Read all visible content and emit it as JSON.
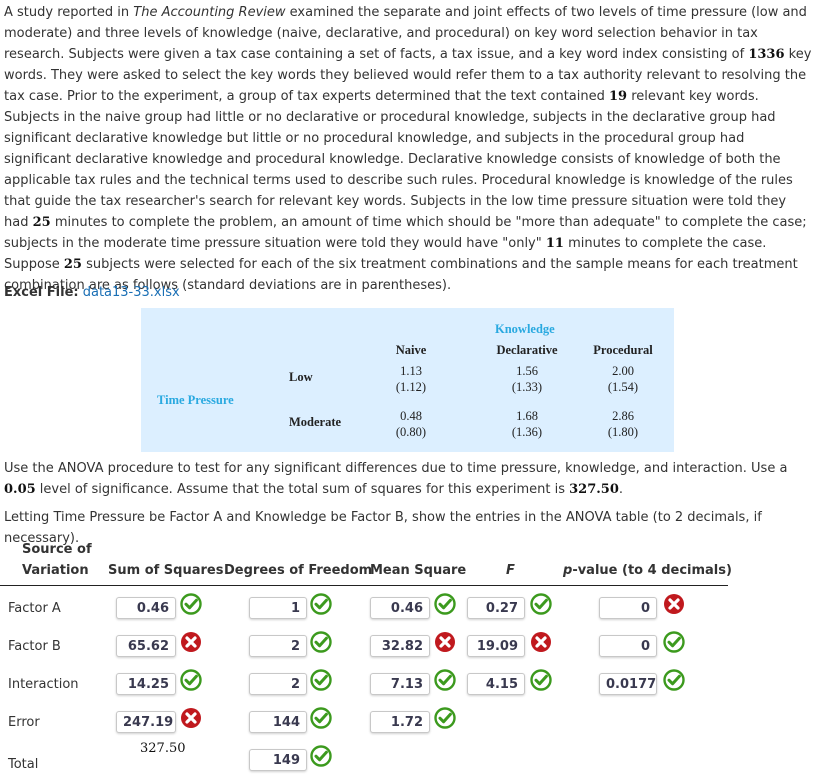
{
  "problem": {
    "intro_parts": [
      {
        "t": "A study reported in "
      },
      {
        "t": "The Accounting Review",
        "style": "italic"
      },
      {
        "t": " examined the separate and joint effects of two levels of time pressure (low and moderate) and three levels of knowledge (naive, declarative, and procedural) on key word selection behavior in tax research. Subjects were given a tax case containing a set of facts, a tax issue, and a key word index consisting of "
      },
      {
        "t": "1336",
        "style": "num"
      },
      {
        "t": " key words. They were asked to select the key words they believed would refer them to a tax authority relevant to resolving the tax case. Prior to the experiment, a group of tax experts determined that the text contained "
      },
      {
        "t": "19",
        "style": "num"
      },
      {
        "t": " relevant key words. Subjects in the naive group had little or no declarative or procedural knowledge, subjects in the declarative group had significant declarative knowledge but little or no procedural knowledge, and subjects in the procedural group had significant declarative knowledge and procedural knowledge. Declarative knowledge consists of knowledge of both the applicable tax rules and the technical terms used to describe such rules. Procedural knowledge is knowledge of the rules that guide the tax researcher's search for relevant key words. Subjects in the low time pressure situation were told they had "
      },
      {
        "t": "25",
        "style": "num"
      },
      {
        "t": " minutes to complete the problem, an amount of time which should be \"more than adequate\" to complete the case; subjects in the moderate time pressure situation were told they would have \"only\" "
      },
      {
        "t": "11",
        "style": "num"
      },
      {
        "t": " minutes to complete the case. Suppose "
      },
      {
        "t": "25",
        "style": "num"
      },
      {
        "t": " subjects were selected for each of the six treatment combinations and the sample means for each treatment combination are as follows (standard deviations are in parentheses)."
      }
    ],
    "excel_label": "Excel File:",
    "excel_link": "data13-33.xlsx",
    "instructions1_parts": [
      {
        "t": "Use the ANOVA procedure to test for any significant differences due to time pressure, knowledge, and interaction. Use a "
      },
      {
        "t": "0.05",
        "style": "num"
      },
      {
        "t": " level of significance. Assume that the total sum of squares for this experiment is "
      },
      {
        "t": "327.50",
        "style": "num"
      },
      {
        "t": "."
      }
    ],
    "instructions2": "Letting Time Pressure be Factor A and Knowledge be Factor B, show the entries in the ANOVA table (to 2 decimals, if necessary)."
  },
  "data_table": {
    "factor_col_title": "Knowledge",
    "factor_row_title": "Time Pressure",
    "columns": [
      "Naive",
      "Declarative",
      "Procedural"
    ],
    "rows": [
      {
        "label": "Low",
        "means": [
          "1.13",
          "1.56",
          "2.00"
        ],
        "sds": [
          "(1.12)",
          "(1.33)",
          "(1.54)"
        ]
      },
      {
        "label": "Moderate",
        "means": [
          "0.48",
          "1.68",
          "2.86"
        ],
        "sds": [
          "(0.80)",
          "(1.36)",
          "(1.80)"
        ]
      }
    ],
    "accent_color": "#29a9e0",
    "background_color": "#dcefff"
  },
  "anova": {
    "headers": {
      "source_line1": "Source of",
      "source_line2": "Variation",
      "ss": "Sum of Squares",
      "df": "Degrees of Freedom",
      "ms": "Mean Square",
      "f": "F",
      "p_prefix": "p",
      "p_suffix": "-value (to 4 decimals)"
    },
    "rows": [
      {
        "label": "Factor A",
        "ss": {
          "value": "0.46",
          "status": "correct"
        },
        "df": {
          "value": "1",
          "status": "correct"
        },
        "ms": {
          "value": "0.46",
          "status": "correct"
        },
        "f": {
          "value": "0.27",
          "status": "correct"
        },
        "p": {
          "value": "0",
          "status": "incorrect"
        }
      },
      {
        "label": "Factor B",
        "ss": {
          "value": "65.62",
          "status": "incorrect"
        },
        "df": {
          "value": "2",
          "status": "correct"
        },
        "ms": {
          "value": "32.82",
          "status": "incorrect"
        },
        "f": {
          "value": "19.09",
          "status": "incorrect"
        },
        "p": {
          "value": "0",
          "status": "correct"
        }
      },
      {
        "label": "Interaction",
        "ss": {
          "value": "14.25",
          "status": "correct"
        },
        "df": {
          "value": "2",
          "status": "correct"
        },
        "ms": {
          "value": "7.13",
          "status": "correct"
        },
        "f": {
          "value": "4.15",
          "status": "correct"
        },
        "p": {
          "value": "0.0177",
          "status": "correct"
        }
      },
      {
        "label": "Error",
        "ss": {
          "value": "247.19",
          "status": "incorrect"
        },
        "df": {
          "value": "144",
          "status": "correct"
        },
        "ms": {
          "value": "1.72",
          "status": "correct"
        }
      },
      {
        "label": "Total",
        "ss_static": "327.50",
        "df": {
          "value": "149",
          "status": "correct"
        }
      }
    ],
    "status_colors": {
      "correct": "#3c9a1e",
      "incorrect": "#c0191e"
    }
  }
}
